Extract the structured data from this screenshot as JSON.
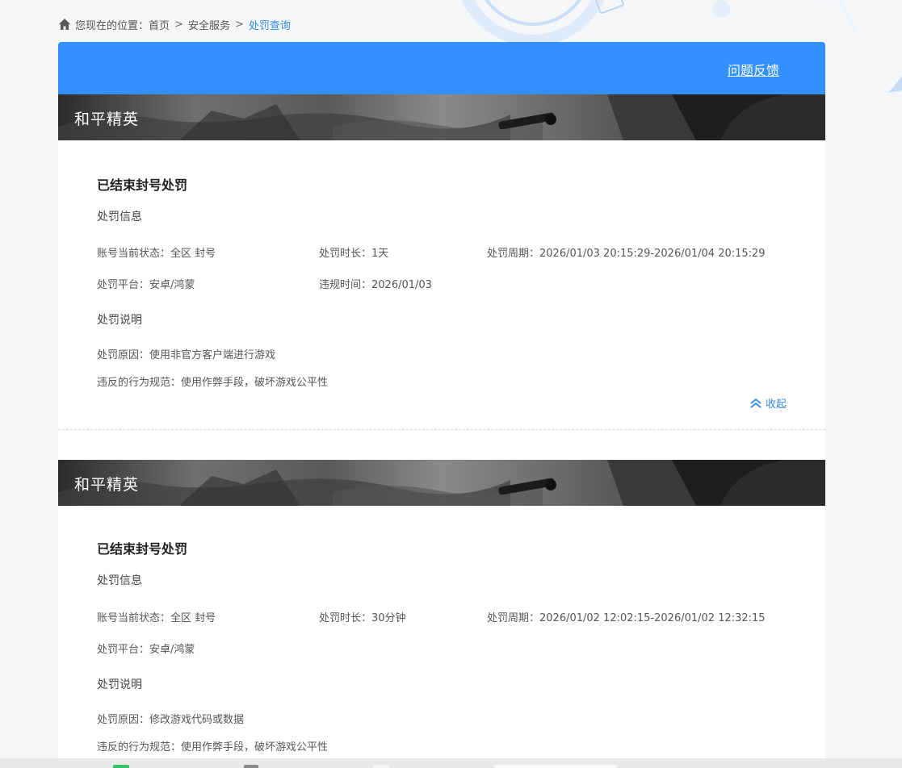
{
  "breadcrumb": {
    "prefix": "您现在的位置：",
    "items": [
      "首页",
      "安全服务"
    ],
    "current": "处罚查询",
    "separator": ">"
  },
  "header": {
    "feedback_label": "问题反馈"
  },
  "records": [
    {
      "game": "和平精英",
      "title": "已结束封号处罚",
      "info_section": "处罚信息",
      "status": "账号当前状态：全区 封号",
      "duration": "处罚时长：1天",
      "period": "处罚周期：2026/01/03 20:15:29-2026/01/04 20:15:29",
      "platform": "处罚平台：安卓/鸿蒙",
      "violation_time": "违规时间：2026/01/03",
      "desc_section": "处罚说明",
      "reason": "处罚原因：使用非官方客户端进行游戏",
      "rule": "违反的行为规范：使用作弊手段，破坏游戏公平性",
      "collapse_label": "收起"
    },
    {
      "game": "和平精英",
      "title": "已结束封号处罚",
      "info_section": "处罚信息",
      "status": "账号当前状态：全区 封号",
      "duration": "处罚时长：30分钟",
      "period": "处罚周期：2026/01/02 12:02:15-2026/01/02 12:32:15",
      "platform": "处罚平台：安卓/鸿蒙",
      "desc_section": "处罚说明",
      "reason": "处罚原因：修改游戏代码或数据",
      "rule": "违反的行为规范：使用作弊手段，破坏游戏公平性"
    }
  ],
  "colors": {
    "header_blue": "#3391fd",
    "link_blue": "#3a8ee6"
  },
  "icons": [
    "home-icon",
    "double-chevron-up-icon"
  ]
}
